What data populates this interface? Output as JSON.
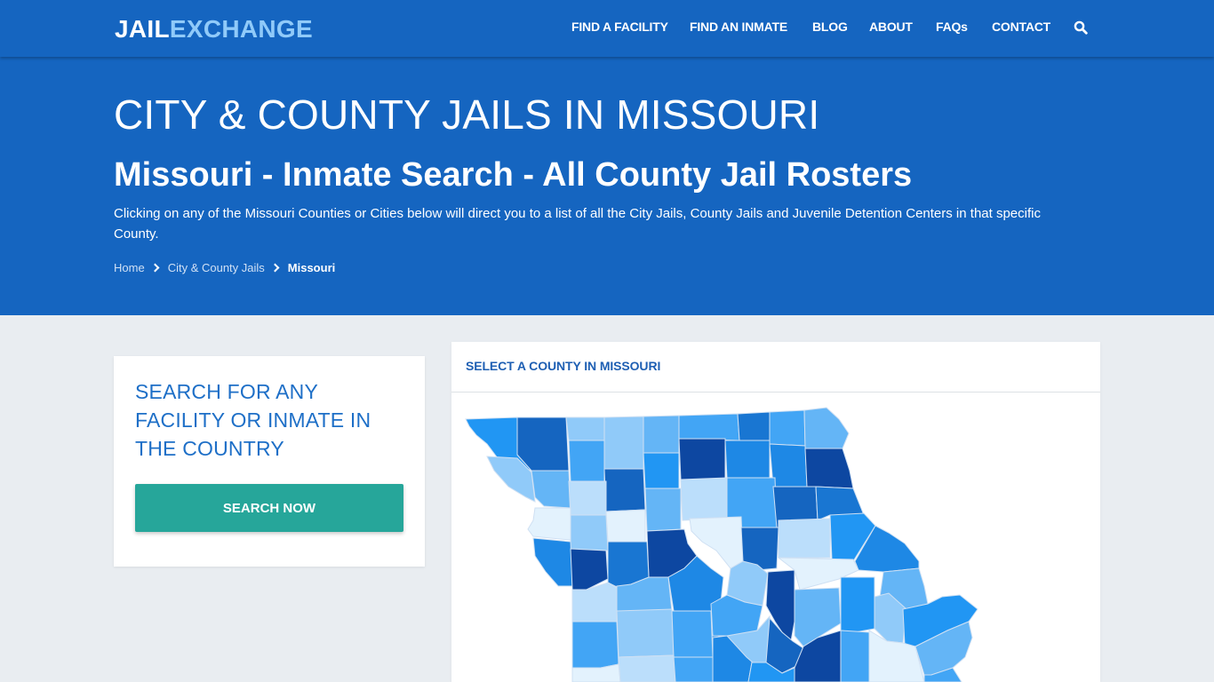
{
  "logo": {
    "part1": "JAIL",
    "part2": "EXCHANGE"
  },
  "nav": {
    "items": [
      {
        "label": "FIND A FACILITY"
      },
      {
        "label": "FIND AN INMATE"
      },
      {
        "label": "BLOG"
      },
      {
        "label": "ABOUT"
      },
      {
        "label": "FAQs"
      },
      {
        "label": "CONTACT"
      }
    ],
    "search_icon": "search-icon"
  },
  "hero": {
    "title": "CITY & COUNTY JAILS IN MISSOURI",
    "subtitle": "Missouri - Inmate Search - All County Jail Rosters",
    "description": "Clicking on any of the Missouri Counties or Cities below will direct you to a list of all the City Jails, County Jails and Juvenile Detention Centers in that specific County.",
    "breadcrumb": [
      {
        "label": "Home"
      },
      {
        "label": "City & County Jails"
      },
      {
        "label": "Missouri"
      }
    ]
  },
  "search_card": {
    "title": "SEARCH FOR ANY FACILITY OR INMATE IN THE COUNTRY",
    "button": "SEARCH NOW"
  },
  "map_card": {
    "title": "SELECT A COUNTY IN MISSOURI",
    "palette": {
      "c0": "#e3f2fd",
      "c1": "#bbdefb",
      "c2": "#90caf9",
      "c3": "#64b5f6",
      "c4": "#42a5f5",
      "c5": "#2196f3",
      "c6": "#1e88e5",
      "c7": "#1976d2",
      "c8": "#1565c0",
      "c9": "#0d47a1"
    }
  },
  "colors": {
    "brand": "#1565c0",
    "logo_accent": "#90caf9",
    "button": "#26a69a",
    "card_title": "#1e6fc7",
    "page_bg": "#e9edf1"
  }
}
